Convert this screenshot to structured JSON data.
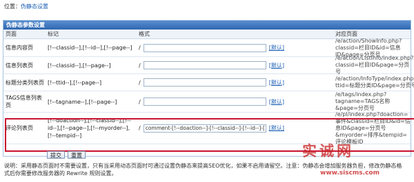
{
  "location": {
    "label": "位置：",
    "link": "伪静态设置"
  },
  "panel": {
    "title": "伪静态参数设置",
    "headers": {
      "page": "页面",
      "mark": "标记",
      "format": "格式",
      "target": "对应页面"
    }
  },
  "rows": [
    {
      "page": "信息内容页",
      "mark": "[!--classid--],[!--id--],[!--page--]",
      "slash": "/",
      "value": "",
      "default_label": "[默认]",
      "target": "/e/action/ShowInfo.php?classid=栏目ID&id=信息ID&page=分页号"
    },
    {
      "page": "信息列表页",
      "mark": "[!--classid--],[!--page--]",
      "slash": "/",
      "value": "",
      "default_label": "[默认]",
      "target": "/e/action/ListInfo/index.php?classid=栏目ID&page=分页号"
    },
    {
      "page": "标题分类列表页",
      "mark": "[!--ttid--],[!--page--]",
      "slash": "/",
      "value": "",
      "default_label": "[默认]",
      "target": "/e/action/InfoType/index.php?ttid=标题分类ID&page=分页号"
    },
    {
      "page": "TAGS信息列表页",
      "mark": "[!--tagname--],[!--page--]",
      "slash": "/",
      "value": "",
      "default_label": "[默认]",
      "target": "/e/tags/index.php?tagname=TAGS名称&page=分页号"
    },
    {
      "page": "评论列表页",
      "mark": "[!--doaction--],[!--classid--],[!--id--],[!--page--],[!--myorder--],[!--tempid--]",
      "slash": "/",
      "value": "comment-[!--doaction--]-[!--classid--]-[!--id--]-[!--page-",
      "default_label": "[默认]",
      "target": "/e/pl/index.php?doaction=事件&classid=栏目ID&id=信息ID&page=分页号&myorder=排序&tempid=评论模板ID"
    }
  ],
  "buttons": {
    "submit": "提交",
    "reset": "重置"
  },
  "note": "说明：采用静态页面时不需要设置，只有当采用动态页面时可通过设置伪静态来提高SEO优化，如果不启用请留空。注意：伪静态会增加服务器负担，修改伪静态格式后你需要修改服务器的 Rewrite 规则设置。",
  "watermark": {
    "brand": "实诚网",
    "url": "www.siscms.com"
  },
  "colors": {
    "title_bar": "#2f67b0",
    "highlight_border": "#c8102e",
    "link": "#1a5fb4"
  }
}
